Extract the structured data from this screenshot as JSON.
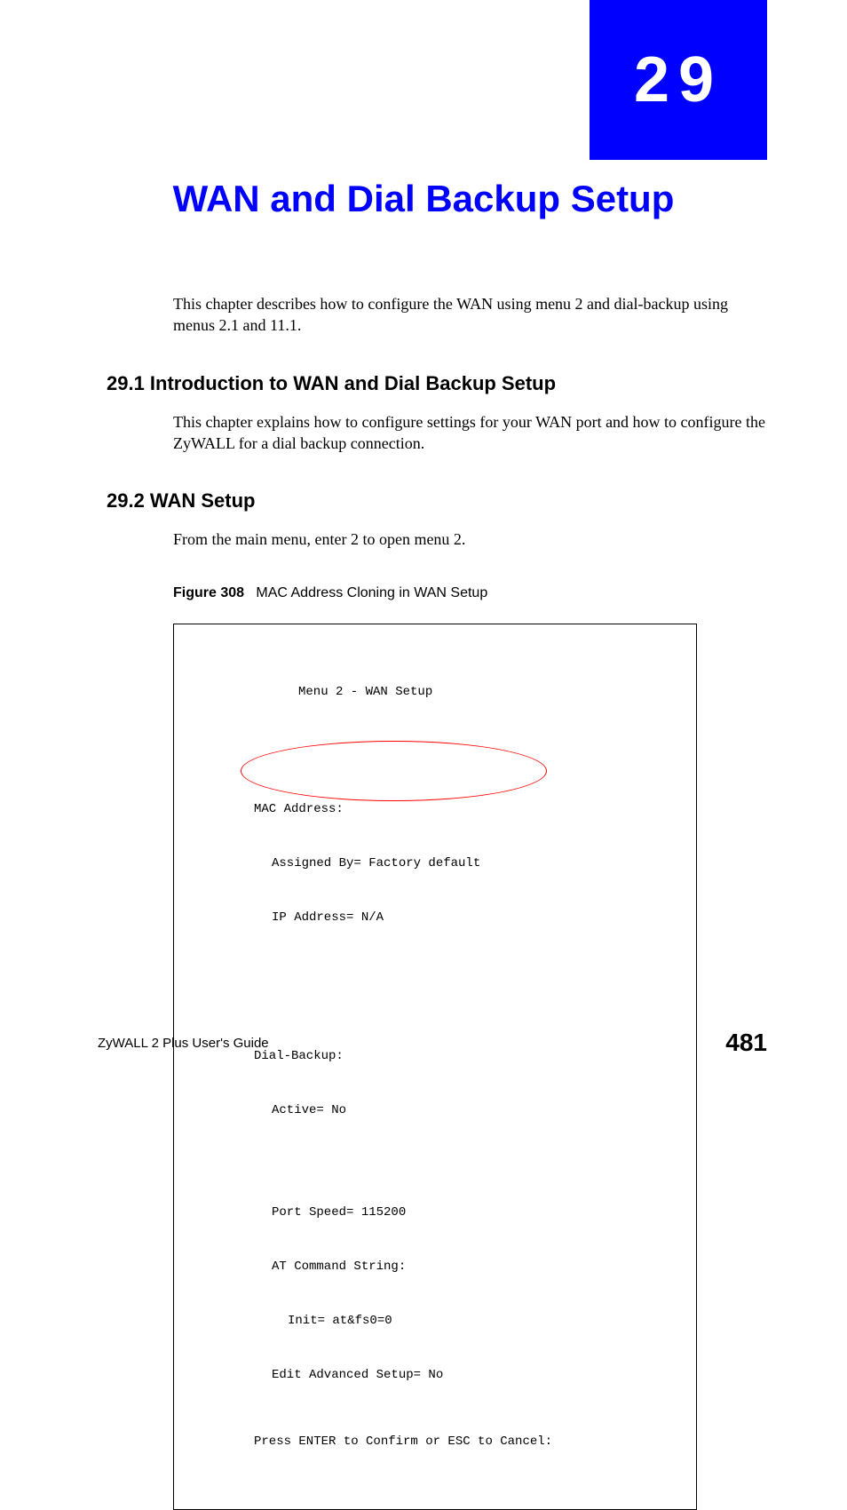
{
  "chapter": {
    "number": "29",
    "title": "WAN and Dial Backup Setup",
    "intro": "This chapter describes how to configure the WAN using menu 2 and dial-backup using menus 2.1 and 11.1."
  },
  "sections": [
    {
      "heading": "29.1  Introduction to WAN and Dial Backup Setup",
      "text": "This chapter explains how to configure settings for your WAN port and how to configure the ZyWALL for a dial backup connection."
    },
    {
      "heading": "29.2  WAN Setup",
      "text": "From the main menu, enter 2 to open menu 2."
    }
  ],
  "figure": {
    "label": "Figure 308",
    "caption": "MAC Address Cloning in WAN Setup"
  },
  "terminal": {
    "title": "Menu 2 - WAN Setup",
    "mac_header": "MAC Address:",
    "mac_assigned": "Assigned By= Factory default",
    "mac_ip": "IP Address= N/A",
    "dial_header": "Dial-Backup:",
    "dial_active": "Active= No",
    "dial_port": "Port Speed= 115200",
    "dial_at": "AT Command String:",
    "dial_init": "Init= at&fs0=0",
    "dial_adv": "Edit Advanced Setup= No",
    "footer": "Press ENTER to Confirm or ESC to Cancel:"
  },
  "footer": {
    "guide": "ZyWALL 2 Plus User's Guide",
    "page": "481"
  }
}
